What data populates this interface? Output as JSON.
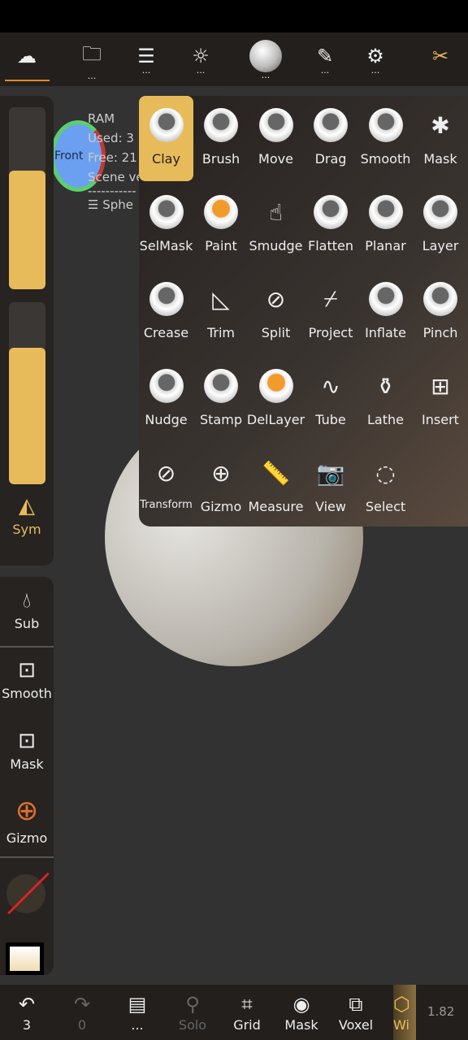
{
  "topbar": {
    "items": [
      {
        "icon": "scene-icon",
        "glyph": "☁",
        "dots": ""
      },
      {
        "icon": "folder-icon",
        "glyph": "🗀",
        "dots": "..."
      },
      {
        "icon": "layers-icon",
        "glyph": "☰",
        "dots": "..."
      },
      {
        "icon": "light-icon",
        "glyph": "☼",
        "dots": "..."
      },
      {
        "icon": "material-sphere-icon",
        "glyph": "",
        "dots": "..."
      },
      {
        "icon": "paint-icon",
        "glyph": "✎",
        "dots": "..."
      },
      {
        "icon": "settings-icon",
        "glyph": "⚙",
        "dots": "..."
      },
      {
        "icon": "tools-icon",
        "glyph": "✂",
        "dots": ""
      }
    ]
  },
  "info": {
    "ram": "RAM",
    "used": "Used: 3",
    "free": "Free: 21",
    "scene": "Scene ve",
    "sep": "-----------",
    "object": "Sphe"
  },
  "axis": {
    "label": "Front"
  },
  "left": {
    "sym": "Sym",
    "sub": "Sub",
    "smooth": "Smooth",
    "mask": "Mask",
    "gizmo": "Gizmo",
    "slider_top_level": 0.65,
    "slider_bottom_level": 0.75
  },
  "tools": [
    {
      "label": "Clay",
      "kind": "sphere",
      "selected": true
    },
    {
      "label": "Brush",
      "kind": "sphere"
    },
    {
      "label": "Move",
      "kind": "sphere"
    },
    {
      "label": "Drag",
      "kind": "sphere"
    },
    {
      "label": "Smooth",
      "kind": "sphere"
    },
    {
      "label": "Mask",
      "kind": "glyph",
      "glyph": "✱"
    },
    {
      "label": "SelMask",
      "kind": "sphere"
    },
    {
      "label": "Paint",
      "kind": "sphere-orange"
    },
    {
      "label": "Smudge",
      "kind": "glyph",
      "glyph": "☝"
    },
    {
      "label": "Flatten",
      "kind": "sphere"
    },
    {
      "label": "Planar",
      "kind": "sphere"
    },
    {
      "label": "Layer",
      "kind": "sphere"
    },
    {
      "label": "Crease",
      "kind": "sphere"
    },
    {
      "label": "Trim",
      "kind": "glyph",
      "glyph": "◺"
    },
    {
      "label": "Split",
      "kind": "glyph",
      "glyph": "⊘"
    },
    {
      "label": "Project",
      "kind": "glyph",
      "glyph": "⌿"
    },
    {
      "label": "Inflate",
      "kind": "sphere"
    },
    {
      "label": "Pinch",
      "kind": "sphere"
    },
    {
      "label": "Nudge",
      "kind": "sphere"
    },
    {
      "label": "Stamp",
      "kind": "sphere"
    },
    {
      "label": "DelLayer",
      "kind": "sphere-orange"
    },
    {
      "label": "Tube",
      "kind": "glyph",
      "glyph": "∿"
    },
    {
      "label": "Lathe",
      "kind": "glyph",
      "glyph": "⚱"
    },
    {
      "label": "Insert",
      "kind": "glyph",
      "glyph": "⊞"
    },
    {
      "label": "Transform",
      "kind": "glyph",
      "glyph": "⊘"
    },
    {
      "label": "Gizmo",
      "kind": "glyph",
      "glyph": "⊕"
    },
    {
      "label": "Measure",
      "kind": "glyph",
      "glyph": "📏"
    },
    {
      "label": "View",
      "kind": "glyph",
      "glyph": "📷"
    },
    {
      "label": "Select",
      "kind": "glyph",
      "glyph": "◌"
    }
  ],
  "bottom": {
    "undo": "3",
    "redo": "0",
    "more": "...",
    "solo": "Solo",
    "grid": "Grid",
    "mask": "Mask",
    "voxel": "Voxel",
    "wire": "Wi",
    "version": "1.82"
  },
  "colors": {
    "accent": "#e8bb5a",
    "panel": "#221f1d"
  }
}
